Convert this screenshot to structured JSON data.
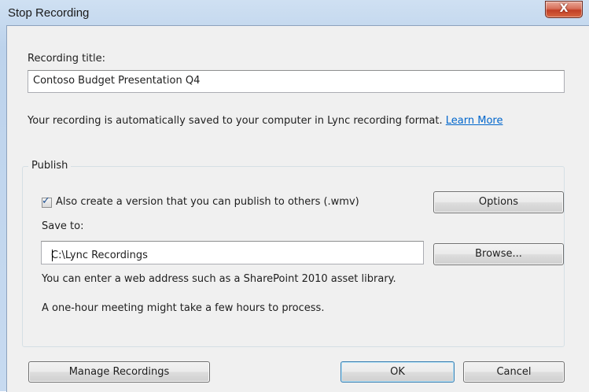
{
  "window": {
    "title": "Stop Recording",
    "close_glyph": "X"
  },
  "recording_title": {
    "label": "Recording title:",
    "value": "Contoso Budget Presentation Q4"
  },
  "info": {
    "text": "Your recording is automatically saved to your computer in Lync recording format.",
    "link": "Learn More"
  },
  "publish": {
    "legend": "Publish",
    "checkbox_label": "Also create a version that you can publish to others (.wmv)",
    "checkbox_checked": true,
    "options_button": "Options",
    "save_to_label": "Save to:",
    "save_to_value": "C:\\Lync Recordings",
    "browse_button": "Browse...",
    "hint_web": "You can enter a web address such as a SharePoint 2010 asset library.",
    "hint_time": "A one-hour meeting might take a few hours to process."
  },
  "footer": {
    "manage_button": "Manage Recordings",
    "ok_button": "OK",
    "cancel_button": "Cancel"
  },
  "icons": {
    "close": "close-icon",
    "check": "checkmark-icon"
  }
}
